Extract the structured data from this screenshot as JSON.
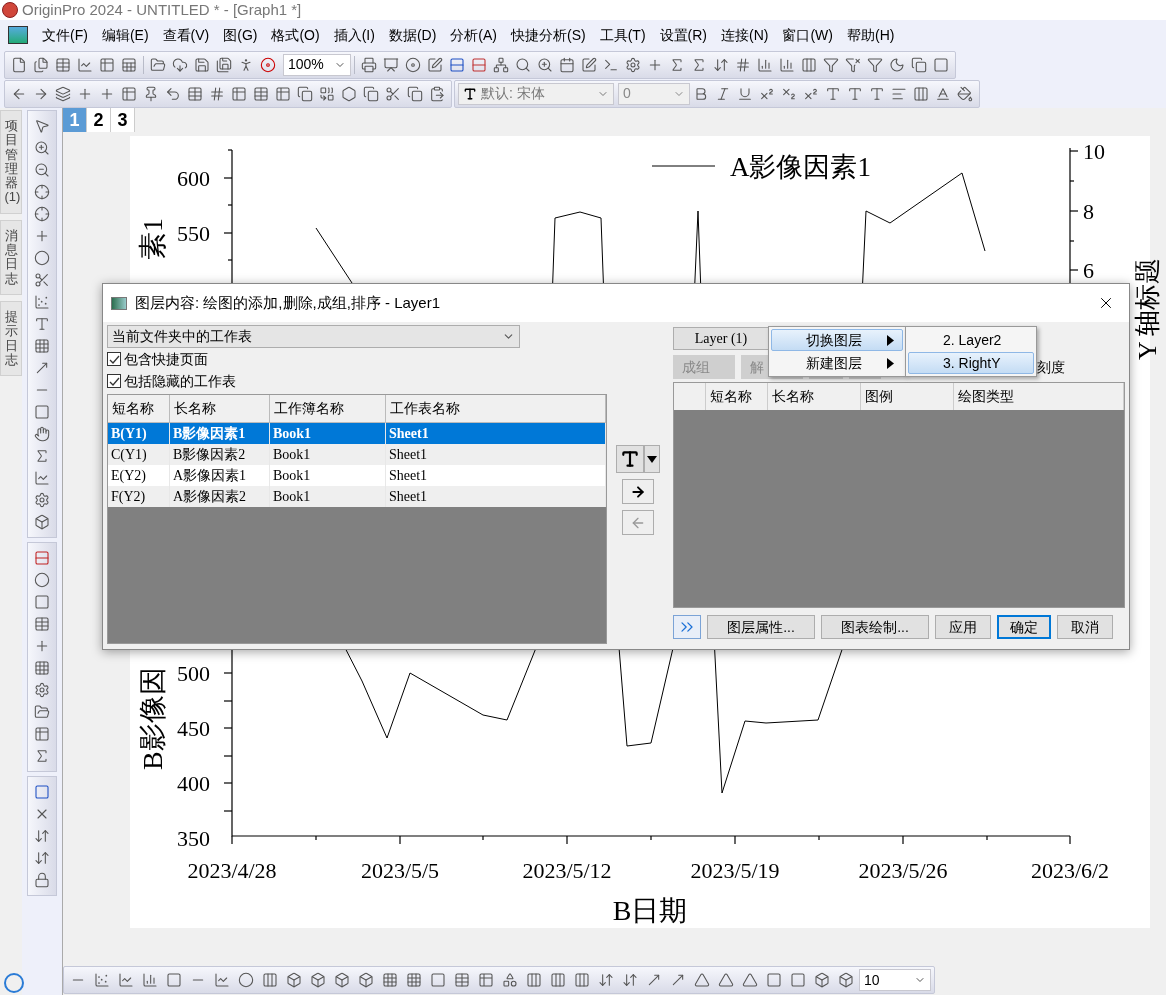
{
  "window": {
    "title": "OriginPro 2024 - UNTITLED * - [Graph1 *]"
  },
  "menu_bar": [
    "文件(F)",
    "编辑(E)",
    "查看(V)",
    "图(G)",
    "格式(O)",
    "插入(I)",
    "数据(D)",
    "分析(A)",
    "快捷分析(S)",
    "工具(T)",
    "设置(R)",
    "连接(N)",
    "窗口(W)",
    "帮助(H)"
  ],
  "toolbar": {
    "zoom": "100%",
    "font": "默认: 宋体",
    "font_size": "0"
  },
  "side_panels": [
    {
      "label": "项目管理器 (1)"
    },
    {
      "label": "消息日志"
    },
    {
      "label": "提示日志"
    }
  ],
  "page_tabs": [
    {
      "label": "1",
      "selected": true
    },
    {
      "label": "2",
      "selected": false
    },
    {
      "label": "3",
      "selected": false
    }
  ],
  "graph": {
    "legend": "A影像因素1",
    "left_ticks": [
      "600",
      "550",
      "500",
      "450",
      "400",
      "350"
    ],
    "right_ticks": [
      "10",
      "8",
      "6"
    ],
    "x_ticks": [
      "2023/4/28",
      "2023/5/5",
      "2023/5/12",
      "2023/5/19",
      "2023/5/26",
      "2023/6/2"
    ],
    "x_title": "B日期",
    "y_title_upper": "素1",
    "y_title_lower": "B影像因",
    "right_title": "Y 轴标题"
  },
  "dialog": {
    "title": "图层内容: 绘图的添加,删除,成组,排序 - Layer1",
    "source": "当前文件夹中的工作表",
    "options": [
      {
        "label": "包含快捷页面",
        "checked": true
      },
      {
        "label": "包括隐藏的工作表",
        "checked": true
      }
    ],
    "available": {
      "columns": [
        "短名称",
        "长名称",
        "工作簿名称",
        "工作表名称"
      ],
      "rows": [
        {
          "cells": [
            "B(Y1)",
            "B影像因素1",
            "Book1",
            "Sheet1"
          ],
          "selected": true
        },
        {
          "cells": [
            "C(Y1)",
            "B影像因素2",
            "Book1",
            "Sheet1"
          ],
          "selected": false
        },
        {
          "cells": [
            "E(Y2)",
            "A影像因素1",
            "Book1",
            "Sheet1"
          ],
          "selected": false
        },
        {
          "cells": [
            "F(Y2)",
            "A影像因素2",
            "Book1",
            "Sheet1"
          ],
          "selected": false
        }
      ]
    },
    "move_buttons": [
      {
        "kind": "add",
        "disabled": false
      },
      {
        "kind": "remove",
        "disabled": true
      }
    ],
    "layer_button": "Layer (1)",
    "group_buttons": [
      {
        "label": "成组",
        "disabled": true
      },
      {
        "label": "解",
        "disabled": true
      }
    ],
    "scale_label": "刻度",
    "plotted": {
      "columns": [
        "短名称",
        "长名称",
        "图例",
        "绘图类型"
      ]
    },
    "buttons": [
      {
        "label": "图层属性...",
        "default": false
      },
      {
        "label": "图表绘制...",
        "default": false
      },
      {
        "label": "应用",
        "default": false
      },
      {
        "label": "确定",
        "default": true
      },
      {
        "label": "取消",
        "default": false
      }
    ]
  },
  "context_menu": {
    "items": [
      {
        "label": "切换图层",
        "selected": true
      },
      {
        "label": "新建图层",
        "selected": false
      }
    ],
    "submenu": [
      {
        "label": "2. Layer2",
        "selected": false
      },
      {
        "label": "3. RightY",
        "selected": true
      }
    ]
  },
  "bottom_toolbar": {
    "size": "10"
  }
}
